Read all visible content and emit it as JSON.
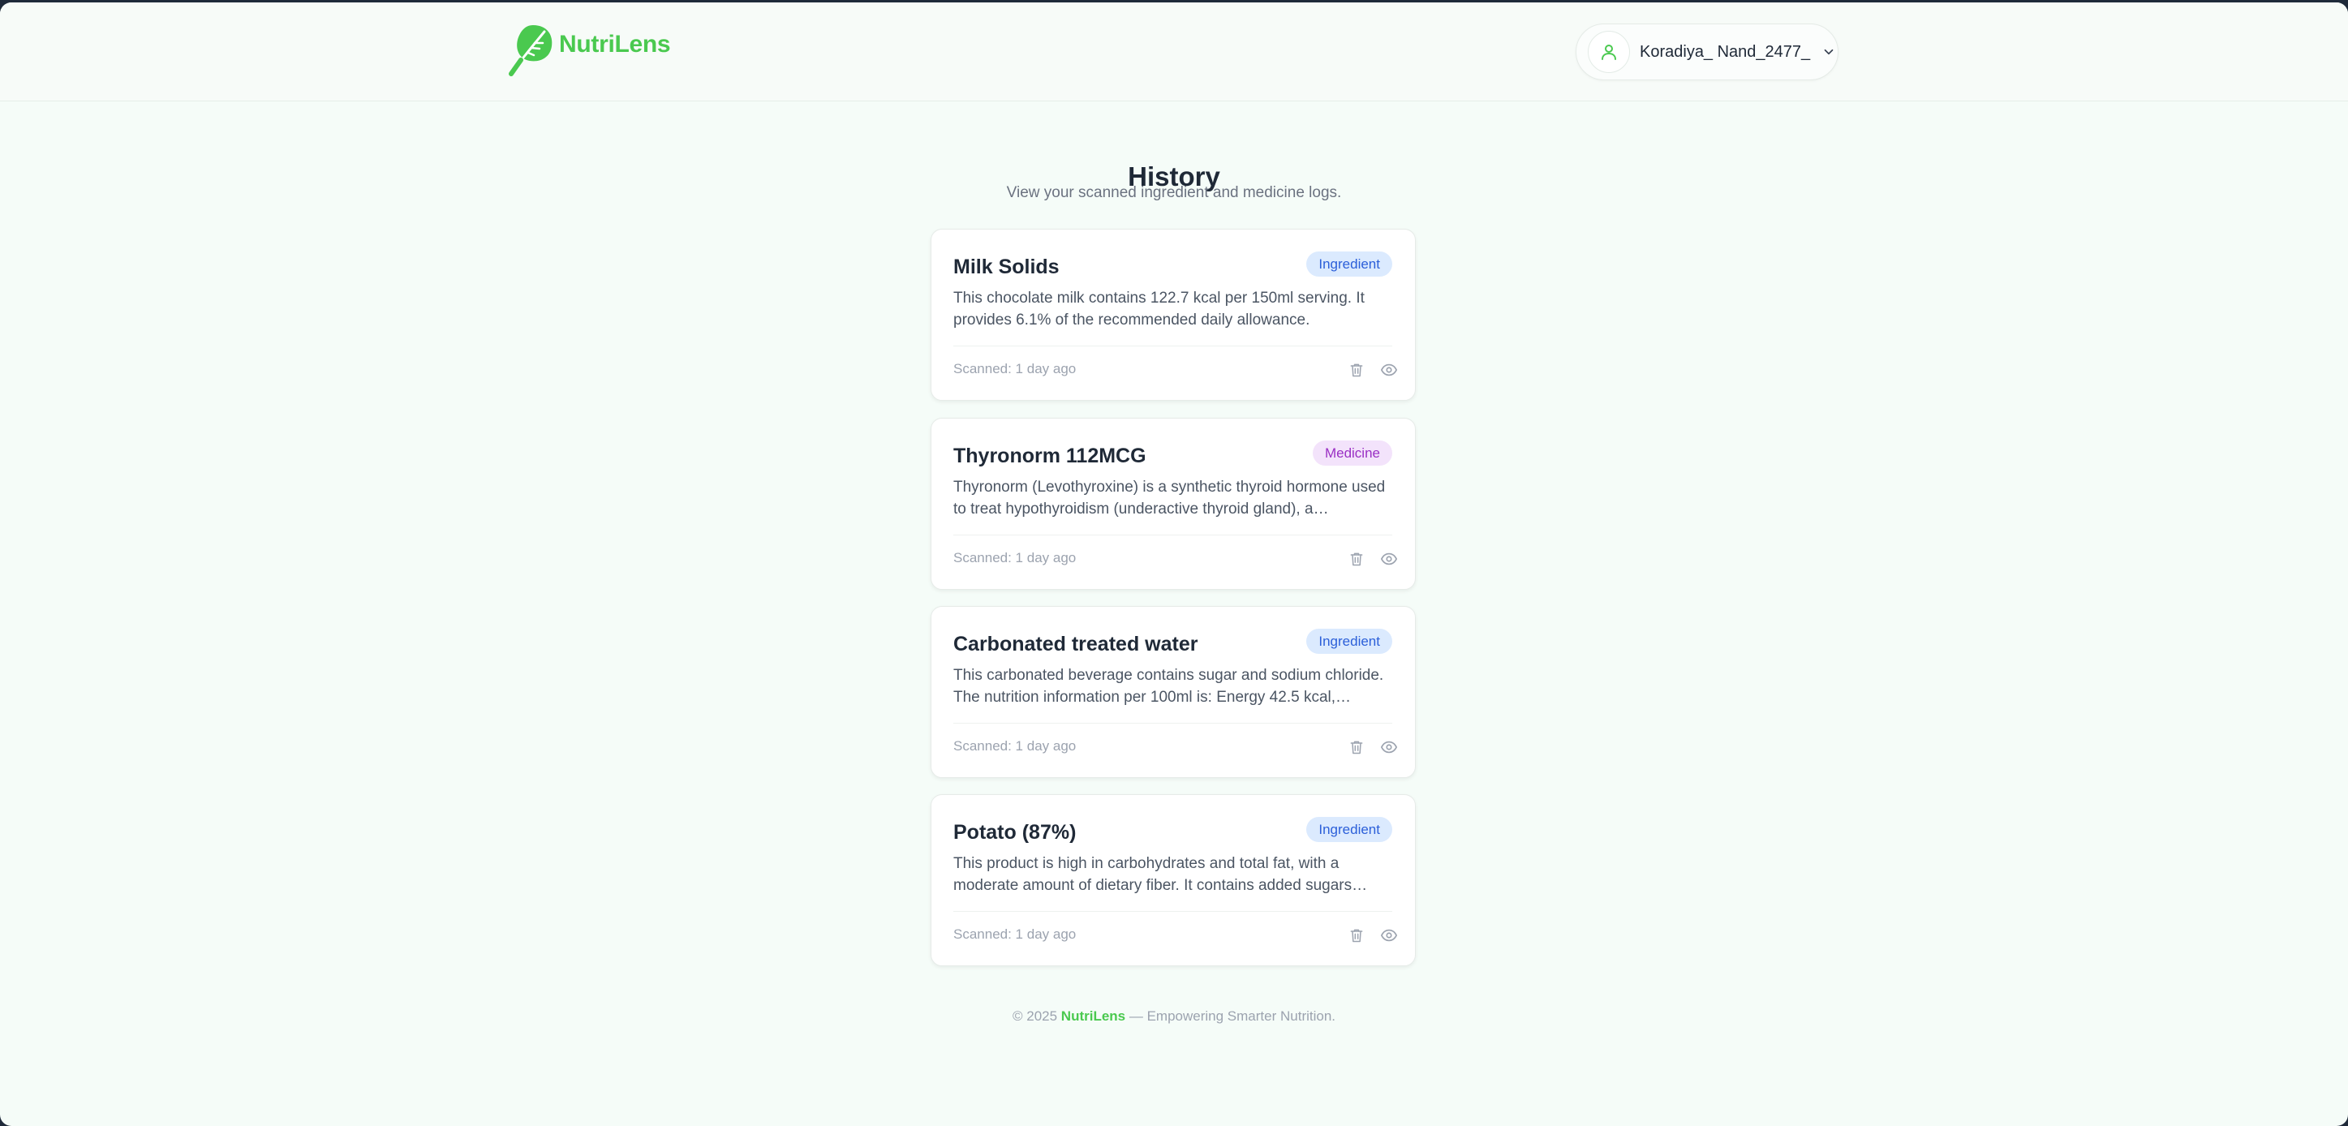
{
  "app": {
    "name": "NutriLens",
    "brand_color": "#4ac94f"
  },
  "user": {
    "name": "Koradiya_ Nand_2477_"
  },
  "page": {
    "title": "History",
    "subtitle": "View your scanned ingredient and medicine logs."
  },
  "history": [
    {
      "title": "Milk Solids",
      "type": "Ingredient",
      "description": "This chocolate milk contains 122.7 kcal per 150ml serving. It provides 6.1% of the recommended daily allowance.",
      "scanned": "Scanned: 1 day ago"
    },
    {
      "title": "Thyronorm 112MCG",
      "type": "Medicine",
      "description": "Thyronorm (Levothyroxine) is a synthetic thyroid hormone used to treat hypothyroidism (underactive thyroid gland), a condition…",
      "scanned": "Scanned: 1 day ago"
    },
    {
      "title": "Carbonated treated water",
      "type": "Ingredient",
      "description": "This carbonated beverage contains sugar and sodium chloride. The nutrition information per 100ml is: Energy 42.5 kcal,…",
      "scanned": "Scanned: 1 day ago"
    },
    {
      "title": "Potato (87%)",
      "type": "Ingredient",
      "description": "This product is high in carbohydrates and total fat, with a moderate amount of dietary fiber. It contains added sugars and…",
      "scanned": "Scanned: 1 day ago"
    }
  ],
  "footer": {
    "prefix": "© 2025",
    "brand": "NutriLens",
    "suffix": "— Empowering Smarter Nutrition."
  },
  "icons": {
    "logo": "leaf-magnifier-icon",
    "avatar": "user-icon",
    "menu": "chevron-down-icon",
    "delete": "trash-icon",
    "view": "eye-icon"
  },
  "colors": {
    "ingredient_badge_bg": "#dbeafe",
    "ingredient_badge_text": "#2b5fd9",
    "medicine_badge_bg": "#f3e3fb",
    "medicine_badge_text": "#9a2fc4"
  }
}
